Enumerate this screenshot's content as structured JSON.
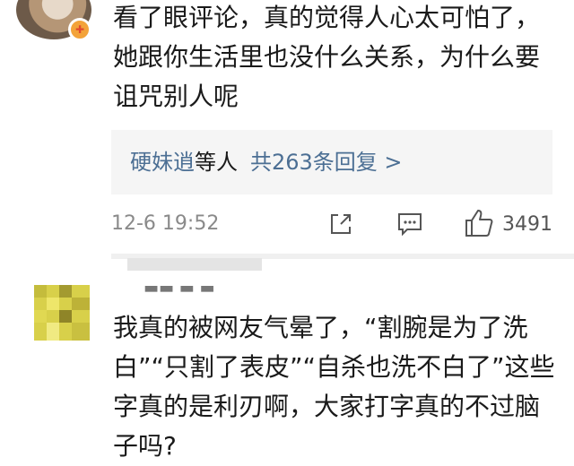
{
  "comment1": {
    "text": "看了眼评论，真的觉得人心太可怕了，她跟你生活里也没什么关系，为什么要诅咒别人呢",
    "replies": {
      "names": "硬妹逍",
      "middle": "等人",
      "count_text": "共263条回复 >"
    },
    "time": "12-6 19:52",
    "likes": "3491",
    "badge_icon": "vip-badge-icon"
  },
  "comment2": {
    "username": "▬▬ ▬ ▬",
    "text": "我真的被网友气晕了，“割腕是为了洗白”“只割了表皮”“自杀也洗不白了”这些字真的是利刃啊，大家打字真的不过脑子吗?"
  },
  "colors": {
    "link_blue": "#4c6f94",
    "meta_gray": "#8a8a8a",
    "box_bg": "#f5f5f5"
  }
}
